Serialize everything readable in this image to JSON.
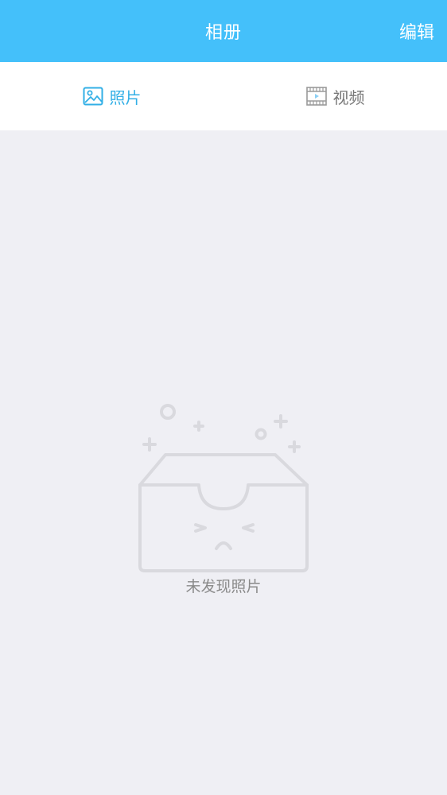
{
  "header": {
    "title": "相册",
    "edit_label": "编辑"
  },
  "tabs": [
    {
      "label": "照片",
      "icon": "image-icon",
      "active": true,
      "color": "#32afe6"
    },
    {
      "label": "视频",
      "icon": "film-icon",
      "active": false,
      "color": "#777777"
    }
  ],
  "empty_state": {
    "icon": "empty-box-icon",
    "message": "未发现照片"
  },
  "colors": {
    "header_bg": "#44c0fa",
    "page_bg": "#efeff4",
    "accent": "#32afe6"
  }
}
